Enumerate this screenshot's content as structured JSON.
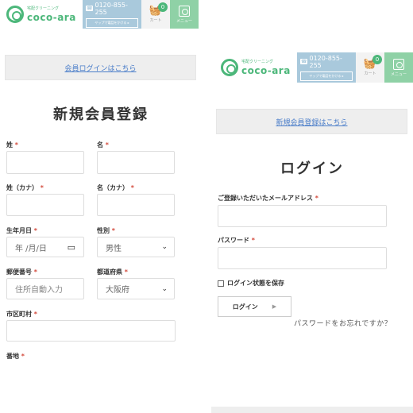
{
  "header": {
    "logo_sub": "宅配クリーニング",
    "logo_main": "coco-ara",
    "tel_icon": "☎",
    "tel": "0120-855-255",
    "tel_button": "ヤップで電話をかける ▸",
    "cart_label": "カート",
    "cart_count": "0",
    "menu_label": "メニュー"
  },
  "register": {
    "login_link": "会員ログインはこちら",
    "title": "新規会員登録",
    "required_mark": "*",
    "fields": {
      "last_name": "姓",
      "first_name": "名",
      "last_name_kana": "姓（カナ）",
      "first_name_kana": "名（カナ）",
      "birthdate": "生年月日",
      "birthdate_placeholder": "年 /月/日",
      "gender": "性別",
      "gender_value": "男性",
      "postal": "郵便番号",
      "postal_placeholder": "住所自動入力",
      "prefecture": "都道府県",
      "prefecture_value": "大阪府",
      "city": "市区町村",
      "address": "番地"
    }
  },
  "login": {
    "register_link": "新規会員登録はこちら",
    "title": "ログイン",
    "email_label": "ご登録いただいたメールアドレス",
    "password_label": "パスワード",
    "remember_label": "ログイン状態を保存",
    "login_button": "ログイン",
    "forgot": "パスワードをお忘れですか？"
  },
  "colors": {
    "brand_green": "#4cb77a",
    "tel_blue": "#a9c9dc",
    "link_blue": "#4a7dc9",
    "required_red": "#d34a3c"
  },
  "icons": {
    "cart": "shopping-basket-icon",
    "menu": "washing-machine-icon",
    "chevron": "chevron-down-icon",
    "calendar": "calendar-icon",
    "arrow": "triangle-right-icon"
  }
}
